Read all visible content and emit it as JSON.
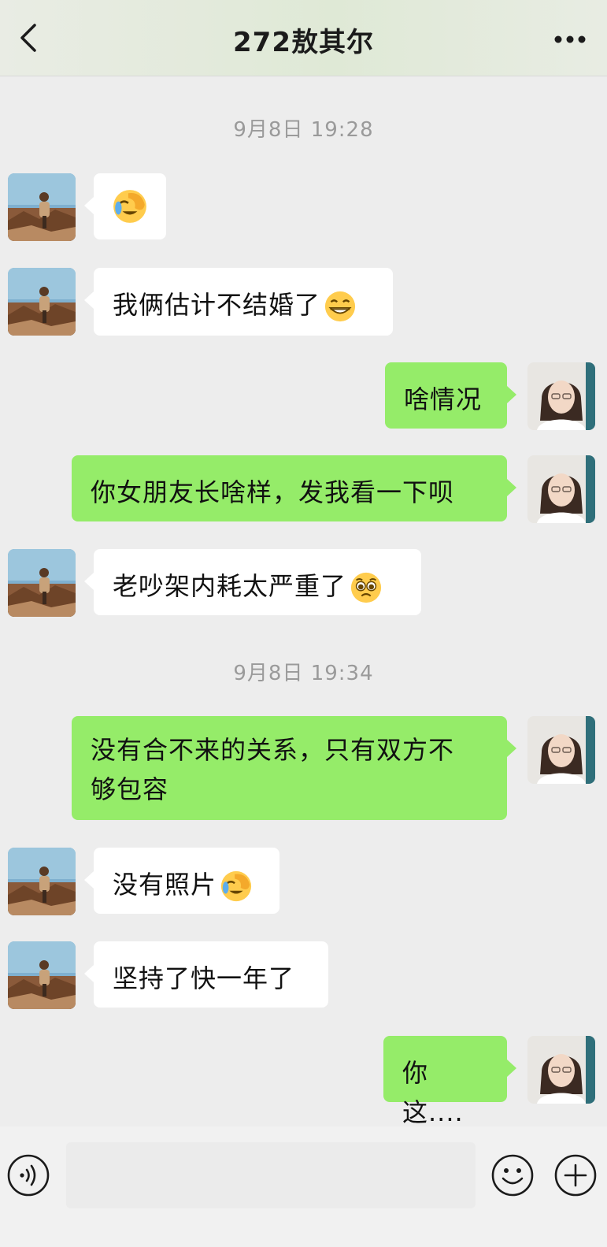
{
  "header": {
    "title": "272敖其尔"
  },
  "messages": {
    "ts1": "9月8日 19:28",
    "m2": "我俩估计不结婚了",
    "m3": "啥情况",
    "m4": "你女朋友长啥样，发我看一下呗",
    "m5": "老吵架内耗太严重了",
    "ts2": "9月8日 19:34",
    "m6a": "没有合不来的关系，只有双方不",
    "m6b": "够包容",
    "m7": "没有照片",
    "m8": "坚持了快一年了",
    "m9": "你这...."
  },
  "emojis": {
    "m1": "facepalm-laughing-emoji",
    "m2": "grimace-grin-emoji",
    "m5": "pleading-face-emoji",
    "m7": "facepalm-laughing-emoji"
  },
  "icons": {
    "back": "chevron-left-icon",
    "more": "more-dots-icon",
    "voice": "voice-icon",
    "emoji": "emoji-icon",
    "plus": "plus-icon"
  },
  "colors": {
    "out_bubble": "#95ec69",
    "in_bubble": "#ffffff",
    "background": "#ededed"
  }
}
